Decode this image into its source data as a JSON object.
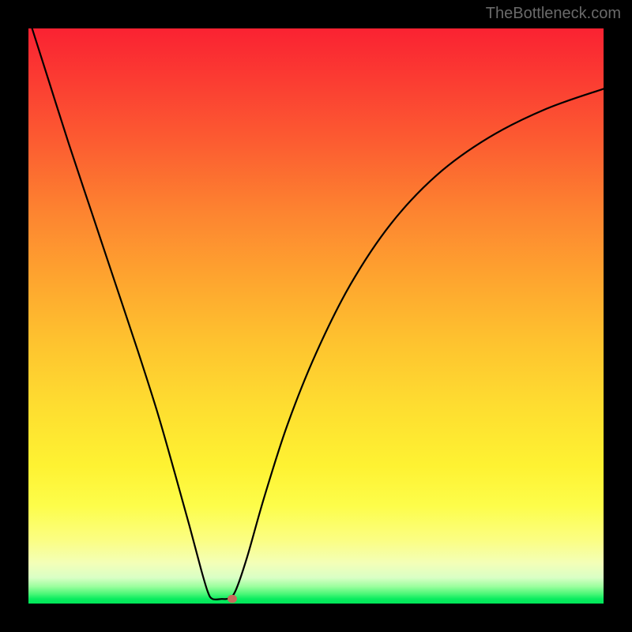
{
  "watermark": {
    "text": "TheBottleneck.com"
  },
  "chart_data": {
    "type": "line",
    "title": "",
    "xlabel": "",
    "ylabel": "",
    "xlim": [
      0,
      1
    ],
    "ylim": [
      0,
      1
    ],
    "gradient_direction": "vertical",
    "gradient_colors": [
      {
        "stop": 0.0,
        "hex": "#fa2232"
      },
      {
        "stop": 0.3,
        "hex": "#fd8030"
      },
      {
        "stop": 0.6,
        "hex": "#fed82f"
      },
      {
        "stop": 0.85,
        "hex": "#fdfe63"
      },
      {
        "stop": 0.95,
        "hex": "#c9ffbd"
      },
      {
        "stop": 1.0,
        "hex": "#01e659"
      }
    ],
    "curve_points": [
      {
        "x": 0.0,
        "y": 1.02
      },
      {
        "x": 0.035,
        "y": 0.91
      },
      {
        "x": 0.07,
        "y": 0.8
      },
      {
        "x": 0.11,
        "y": 0.68
      },
      {
        "x": 0.15,
        "y": 0.56
      },
      {
        "x": 0.19,
        "y": 0.44
      },
      {
        "x": 0.225,
        "y": 0.33
      },
      {
        "x": 0.255,
        "y": 0.225
      },
      {
        "x": 0.28,
        "y": 0.135
      },
      {
        "x": 0.3,
        "y": 0.06
      },
      {
        "x": 0.312,
        "y": 0.02
      },
      {
        "x": 0.32,
        "y": 0.008
      },
      {
        "x": 0.336,
        "y": 0.008
      },
      {
        "x": 0.348,
        "y": 0.009
      },
      {
        "x": 0.36,
        "y": 0.022
      },
      {
        "x": 0.38,
        "y": 0.08
      },
      {
        "x": 0.41,
        "y": 0.185
      },
      {
        "x": 0.45,
        "y": 0.31
      },
      {
        "x": 0.5,
        "y": 0.435
      },
      {
        "x": 0.56,
        "y": 0.555
      },
      {
        "x": 0.63,
        "y": 0.66
      },
      {
        "x": 0.71,
        "y": 0.745
      },
      {
        "x": 0.8,
        "y": 0.81
      },
      {
        "x": 0.9,
        "y": 0.86
      },
      {
        "x": 1.0,
        "y": 0.895
      }
    ],
    "marker": {
      "x": 0.354,
      "y": 0.008,
      "shape": "rounded-rect",
      "color": "#c86a5c"
    }
  }
}
